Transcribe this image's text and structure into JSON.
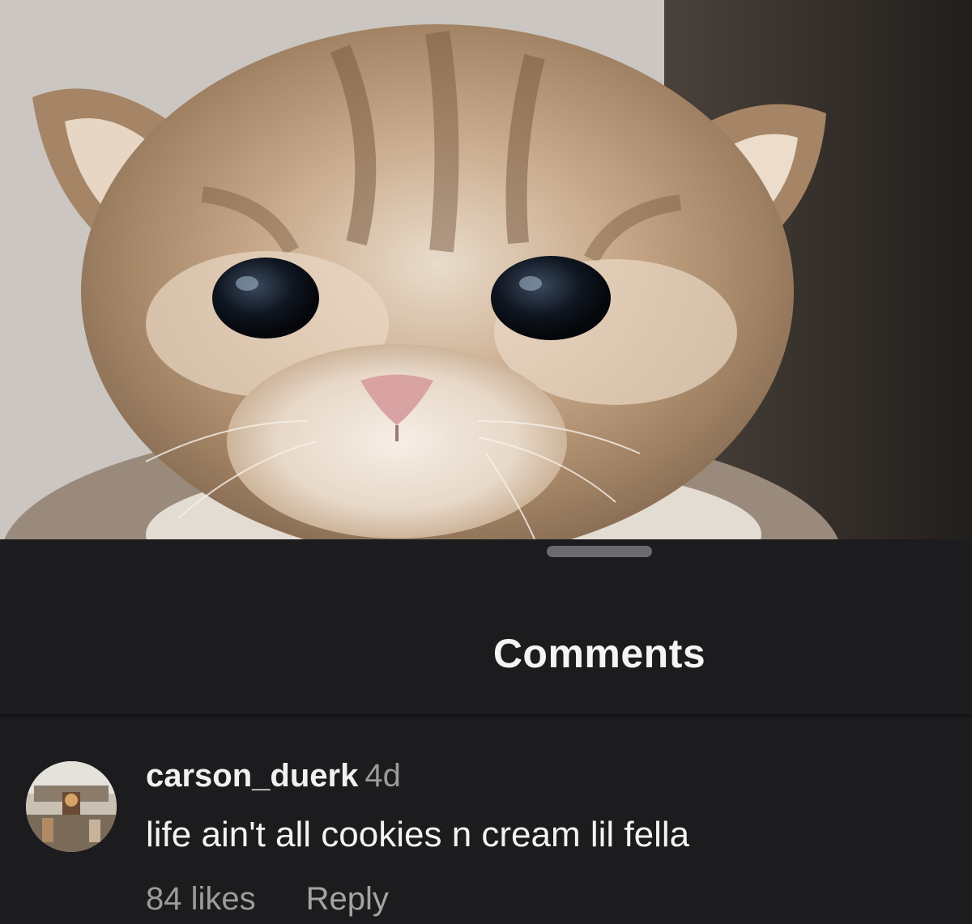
{
  "post": {
    "image_subject": "kitten-photo"
  },
  "sheet": {
    "title": "Comments"
  },
  "comments": [
    {
      "username": "carson_duerk",
      "time_ago": "4d",
      "text": "life ain't all cookies n cream lil fella",
      "likes": "84 likes",
      "reply_label": "Reply"
    }
  ],
  "colors": {
    "sheet_background": "#1c1c1e",
    "primary_text": "#f1f1f1",
    "secondary_text": "#9a9a9a",
    "handle": "#6b6b6e"
  }
}
